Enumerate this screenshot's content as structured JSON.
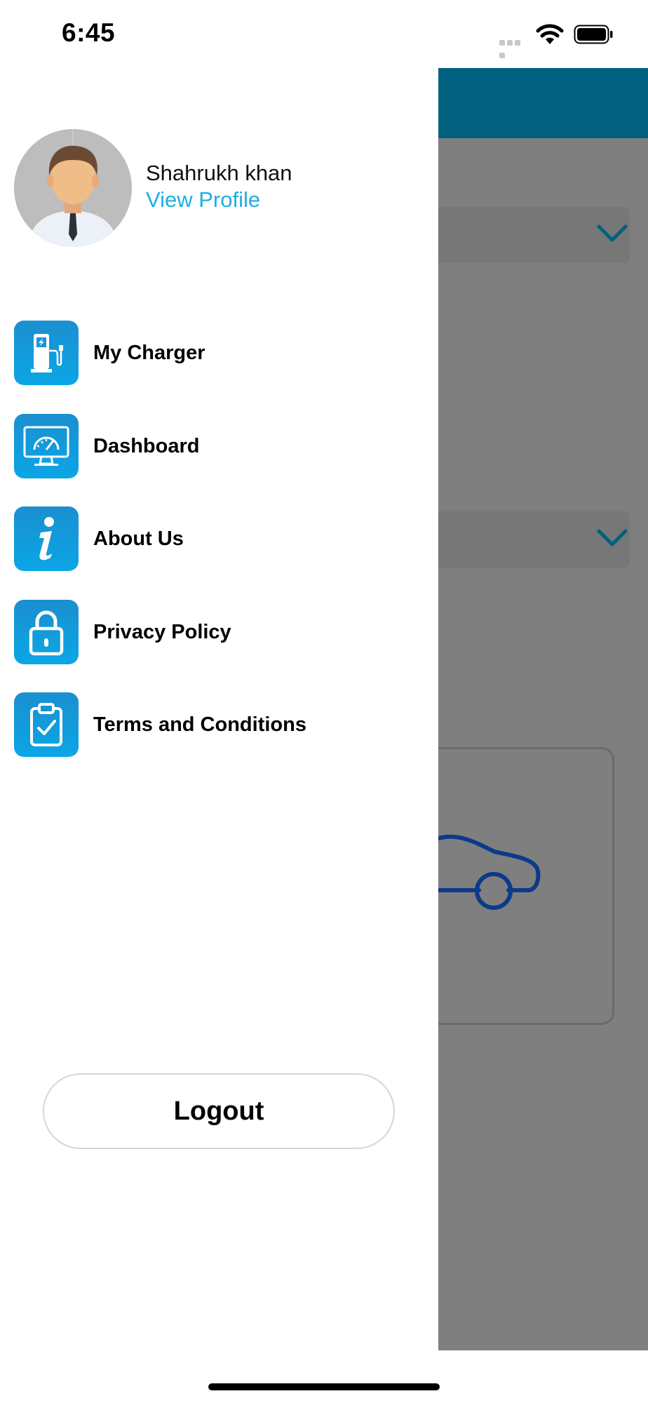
{
  "status_bar": {
    "time": "6:45"
  },
  "drawer": {
    "profile": {
      "name": "Shahrukh khan",
      "link_label": "View Profile",
      "link_color": "#1eaee6"
    },
    "menu": [
      {
        "label": "My Charger",
        "icon": "ev-charger-icon"
      },
      {
        "label": "Dashboard",
        "icon": "dashboard-monitor-icon"
      },
      {
        "label": "About Us",
        "icon": "info-icon"
      },
      {
        "label": "Privacy Policy",
        "icon": "lock-icon"
      },
      {
        "label": "Terms and Conditions",
        "icon": "clipboard-check-icon"
      }
    ],
    "icon_color": "#0ba6e6",
    "logout_label": "Logout"
  },
  "background_app": {
    "header_color": "#02607f",
    "overlay_color": "#7f7f7f"
  }
}
